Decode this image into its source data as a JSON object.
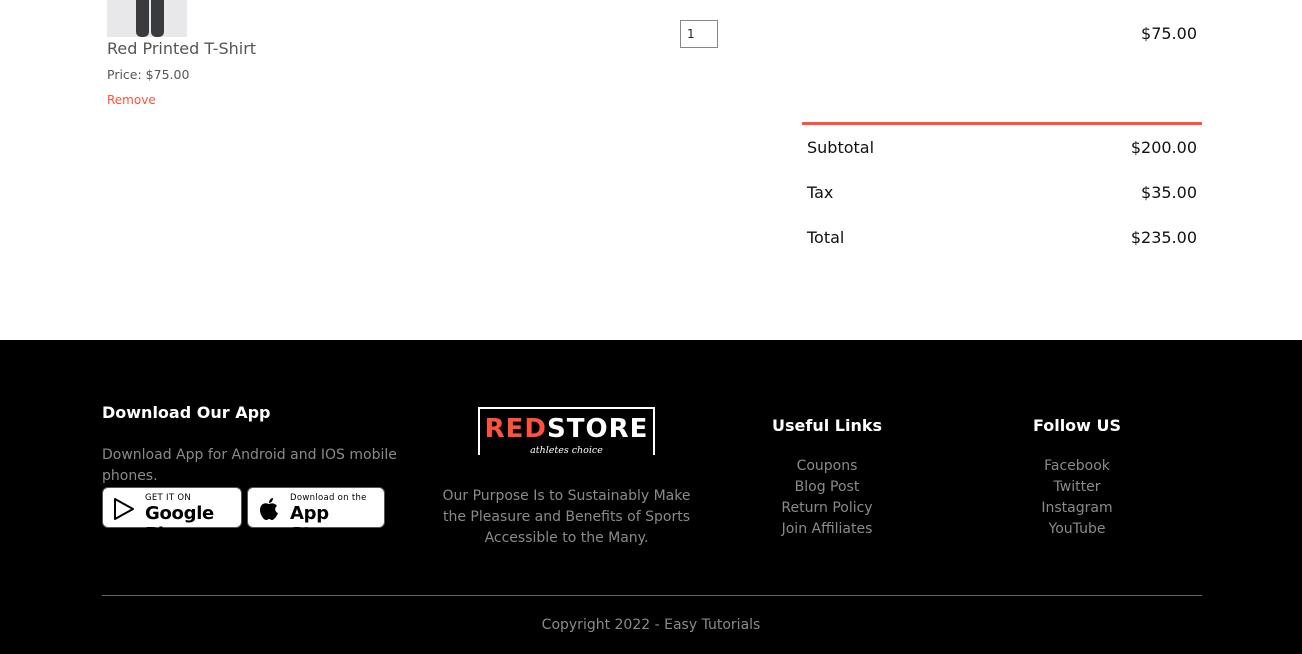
{
  "cart": {
    "item": {
      "name": "Red Printed T-Shirt",
      "price": "Price: $75.00",
      "remove": "Remove",
      "quantity": "1",
      "subtotal": "$75.00",
      "image": "pants-product-image"
    },
    "totals": {
      "subtotal_label": "Subtotal",
      "subtotal_value": "$200.00",
      "tax_label": "Tax",
      "tax_value": "$35.00",
      "total_label": "Total",
      "total_value": "$235.00"
    }
  },
  "footer": {
    "app": {
      "heading": "Download Our App",
      "text": "Download App for Android and IOS mobile phones.",
      "google_small": "GET IT ON",
      "google_big": "Google Play",
      "apple_small": "Download on the",
      "apple_big": "App Store"
    },
    "brand": {
      "logo_red": "RED",
      "logo_white": "STORE",
      "logo_tagline": "athletes choice",
      "purpose": "Our Purpose Is to Sustainably Make the Pleasure and Benefits of Sports Accessible to the Many."
    },
    "useful_links": {
      "heading": "Useful Links",
      "items": [
        "Coupons",
        "Blog Post",
        "Return Policy",
        "Join Affiliates"
      ]
    },
    "follow": {
      "heading": "Follow US",
      "items": [
        "Facebook",
        "Twitter",
        "Instagram",
        "YouTube"
      ]
    },
    "copyright": "Copyright 2022 - Easy Tutorials"
  },
  "colors": {
    "accent": "#ff523b",
    "footer_bg": "#000000",
    "footer_text": "#8a8a8a"
  }
}
